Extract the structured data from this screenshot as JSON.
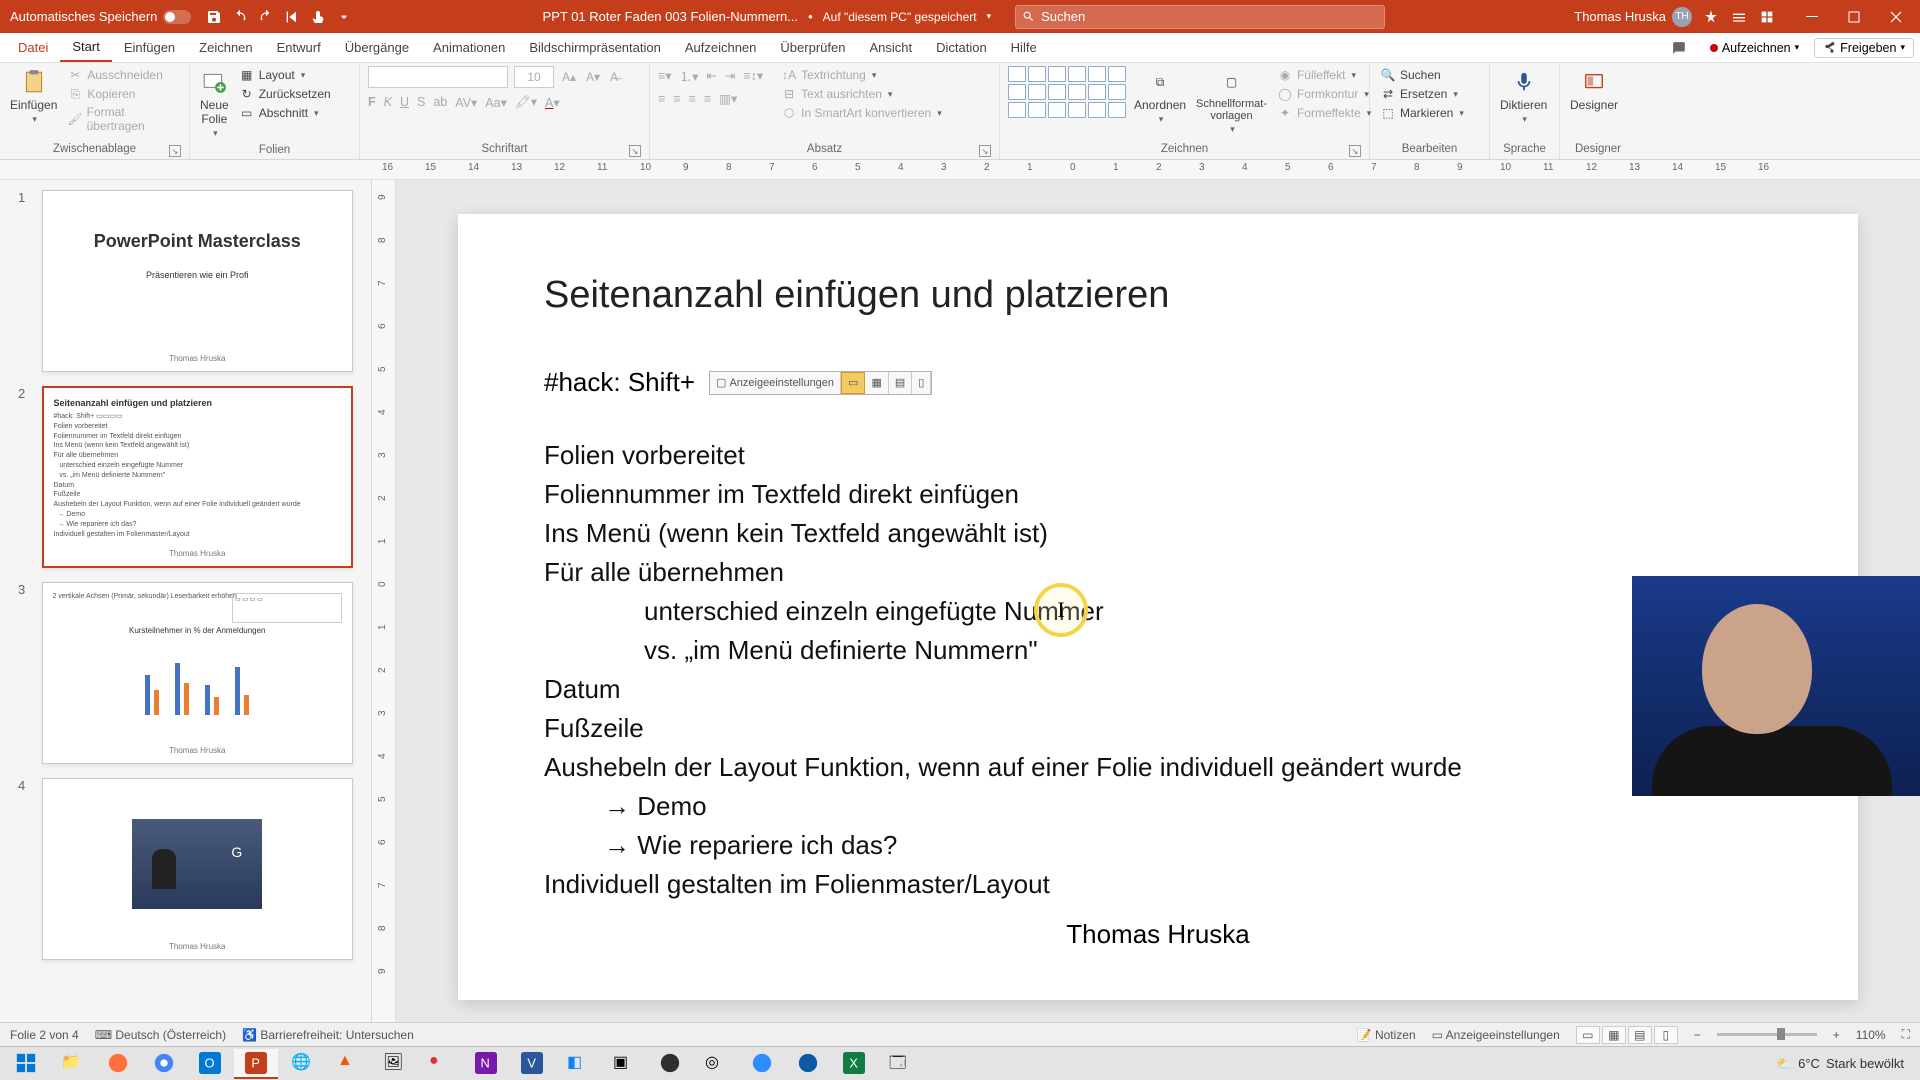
{
  "titlebar": {
    "autosave_label": "Automatisches Speichern",
    "filename": "PPT 01 Roter Faden 003 Folien-Nummern...",
    "saved_location": "Auf \"diesem PC\" gespeichert",
    "search_placeholder": "Suchen",
    "username": "Thomas Hruska",
    "user_initials": "TH"
  },
  "tabs": {
    "file": "Datei",
    "home": "Start",
    "insert": "Einfügen",
    "draw": "Zeichnen",
    "design": "Entwurf",
    "transitions": "Übergänge",
    "animations": "Animationen",
    "slideshow": "Bildschirmpräsentation",
    "record_tab": "Aufzeichnen",
    "review": "Überprüfen",
    "view": "Ansicht",
    "dictation": "Dictation",
    "help": "Hilfe",
    "record_btn": "Aufzeichnen",
    "share": "Freigeben"
  },
  "ribbon": {
    "clipboard_label": "Zwischenablage",
    "paste": "Einfügen",
    "cut": "Ausschneiden",
    "copy": "Kopieren",
    "format_painter": "Format übertragen",
    "slides_label": "Folien",
    "new_slide": "Neue\nFolie",
    "layout": "Layout",
    "reset": "Zurücksetzen",
    "section": "Abschnitt",
    "font_label": "Schriftart",
    "font_size": "10",
    "paragraph_label": "Absatz",
    "text_direction": "Textrichtung",
    "align_text": "Text ausrichten",
    "smartart": "In SmartArt konvertieren",
    "drawing_label": "Zeichnen",
    "arrange": "Anordnen",
    "quick_styles": "Schnellformat-\nvorlagen",
    "shape_fill": "Fülleffekt",
    "shape_outline": "Formkontur",
    "shape_effects": "Formeffekte",
    "editing_label": "Bearbeiten",
    "find": "Suchen",
    "replace": "Ersetzen",
    "select": "Markieren",
    "voice_label": "Sprache",
    "dictate": "Diktieren",
    "designer_label": "Designer",
    "designer": "Designer"
  },
  "ruler_h": [
    "16",
    "15",
    "14",
    "13",
    "12",
    "11",
    "10",
    "9",
    "8",
    "7",
    "6",
    "5",
    "4",
    "3",
    "2",
    "1",
    "0",
    "1",
    "2",
    "3",
    "4",
    "5",
    "6",
    "7",
    "8",
    "9",
    "10",
    "11",
    "12",
    "13",
    "14",
    "15",
    "16"
  ],
  "ruler_v": [
    "9",
    "8",
    "7",
    "6",
    "5",
    "4",
    "3",
    "2",
    "1",
    "0",
    "1",
    "2",
    "3",
    "4",
    "5",
    "6",
    "7",
    "8",
    "9"
  ],
  "thumbs": {
    "s1_title": "PowerPoint Masterclass",
    "s1_sub": "Präsentieren wie ein Profi",
    "s2_title": "Seitenanzahl einfügen und platzieren",
    "s3": {
      "title": "Kursteilnehmer in % der Anmeldungen",
      "legend1": "2 vertikale Achsen (Primär, sekundär) Leserbarkeit erhöhen"
    },
    "author": "Thomas Hruska"
  },
  "slide": {
    "title": "Seitenanzahl einfügen und platzieren",
    "hack_prefix": "#hack: Shift+",
    "toolbar_item": "Anzeigeeinstellungen",
    "lines": {
      "l1": "Folien vorbereitet",
      "l2": "Foliennummer im Textfeld direkt einfügen",
      "l3": "Ins Menü (wenn kein Textfeld angewählt ist)",
      "l4": "Für alle übernehmen",
      "l5": "unterschied  einzeln eingefügte Nummer",
      "l6": "vs. „im Menü definierte Nummern\"",
      "l7": "Datum",
      "l8": "Fußzeile",
      "l9": "Aushebeln der Layout Funktion, wenn auf einer Folie individuell geändert wurde",
      "l10": "Demo",
      "l11": "Wie repariere ich das?",
      "l12": "Individuell gestalten im Folienmaster/Layout"
    },
    "author": "Thomas Hruska"
  },
  "statusbar": {
    "slide_of": "Folie 2 von 4",
    "language": "Deutsch (Österreich)",
    "accessibility": "Barrierefreiheit: Untersuchen",
    "notes": "Notizen",
    "display_settings": "Anzeigeeinstellungen",
    "zoom": "110%"
  },
  "taskbar": {
    "temperature": "6°C",
    "weather_text": "Stark bewölkt"
  }
}
